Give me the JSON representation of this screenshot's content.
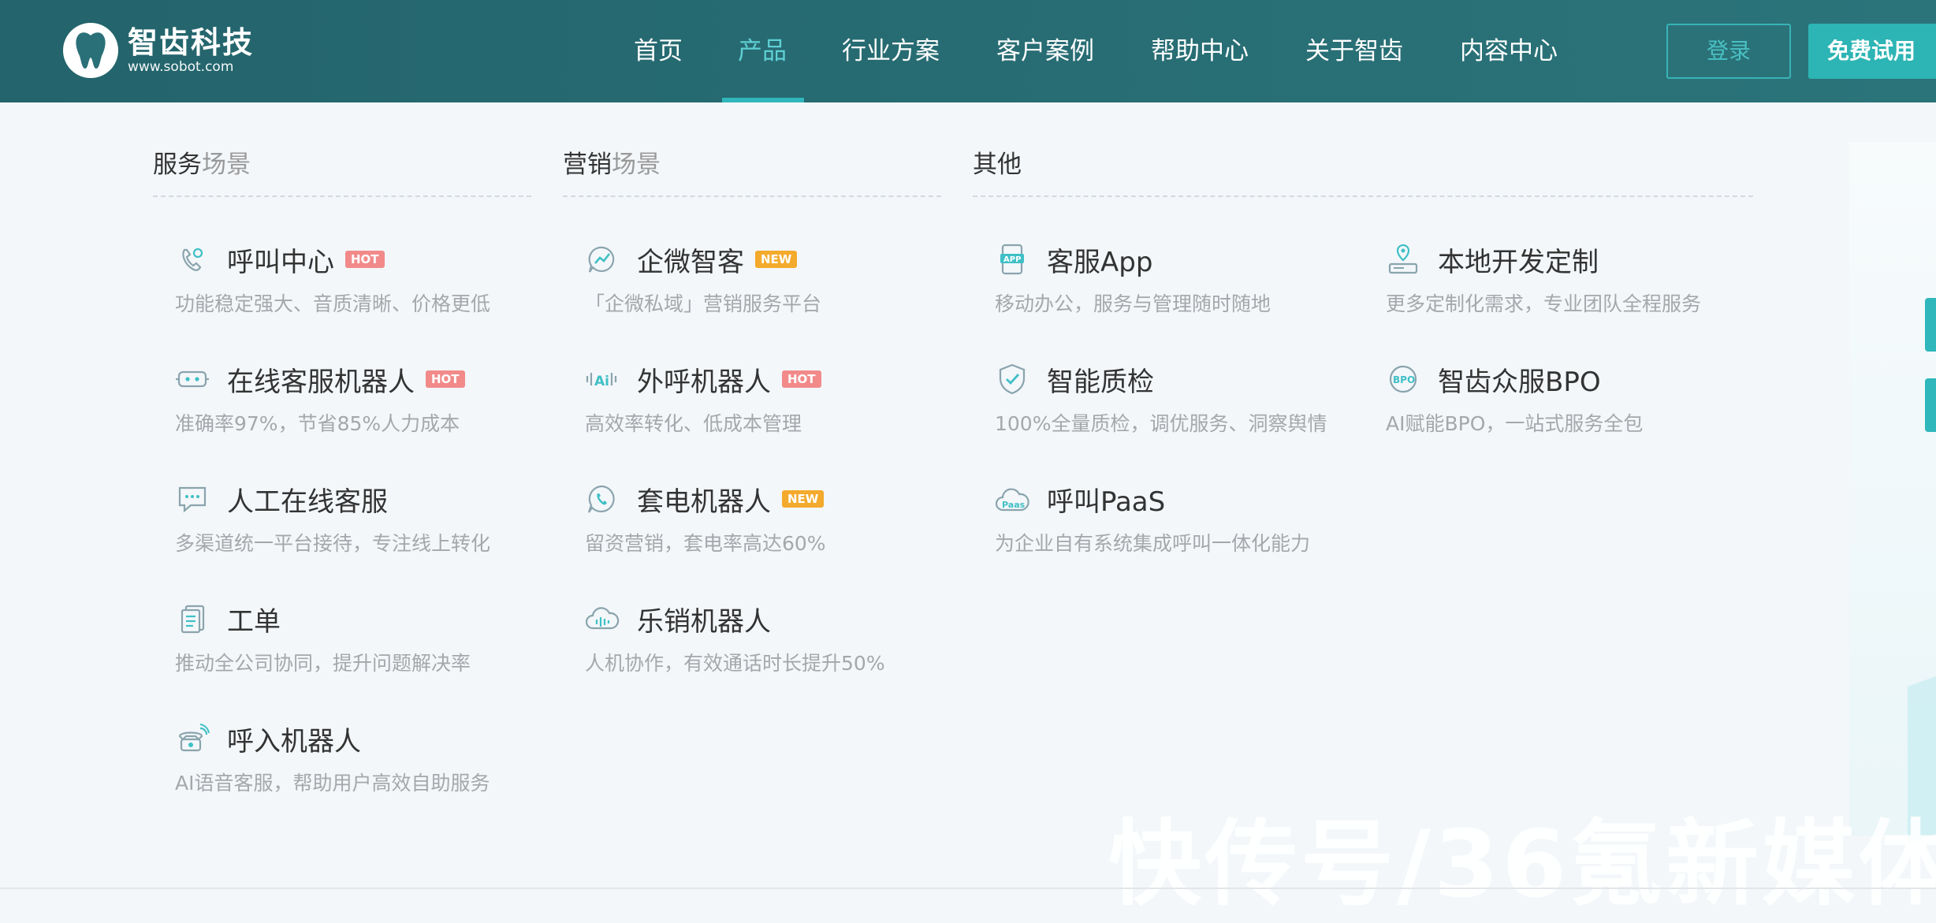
{
  "header": {
    "logo_cn": "智齿科技",
    "logo_url": "www.sobot.com",
    "nav": [
      {
        "label": "首页"
      },
      {
        "label": "产品",
        "active": true
      },
      {
        "label": "行业方案"
      },
      {
        "label": "客户案例"
      },
      {
        "label": "帮助中心"
      },
      {
        "label": "关于智齿"
      },
      {
        "label": "内容中心"
      }
    ],
    "login_label": "登录",
    "trial_label": "免费试用"
  },
  "menu": {
    "service": {
      "title_main": "服务",
      "title_sub": "场景",
      "items": [
        {
          "name": "呼叫中心",
          "badge": "HOT",
          "desc": "功能稳定强大、音质清晰、价格更低",
          "icon": "phone-call-icon"
        },
        {
          "name": "在线客服机器人",
          "badge": "HOT",
          "desc": "准确率97%，节省85%人力成本",
          "icon": "robot-icon"
        },
        {
          "name": "人工在线客服",
          "desc": "多渠道统一平台接待，专注线上转化",
          "icon": "chat-bubble-icon"
        },
        {
          "name": "工单",
          "desc": "推动全公司协同，提升问题解决率",
          "icon": "document-icon"
        },
        {
          "name": "呼入机器人",
          "desc": "AI语音客服，帮助用户高效自助服务",
          "icon": "telephone-icon"
        }
      ]
    },
    "marketing": {
      "title_main": "营销",
      "title_sub": "场景",
      "items": [
        {
          "name": "企微智客",
          "badge": "NEW",
          "desc": "「企微私域」营销服务平台",
          "icon": "trend-chat-icon"
        },
        {
          "name": "外呼机器人",
          "badge": "HOT",
          "desc": "高效率转化、低成本管理",
          "icon": "ai-voice-icon"
        },
        {
          "name": "套电机器人",
          "badge": "NEW",
          "desc": "留资营销，套电率高达60%",
          "icon": "phone-bubble-icon"
        },
        {
          "name": "乐销机器人",
          "desc": "人机协作，有效通话时长提升50%",
          "icon": "cloud-wave-icon"
        }
      ]
    },
    "other": {
      "title_main": "其他",
      "items": [
        {
          "name": "客服App",
          "desc": "移动办公，服务与管理随时随地",
          "icon": "app-icon"
        },
        {
          "name": "本地开发定制",
          "desc": "更多定制化需求，专业团队全程服务",
          "icon": "server-pin-icon"
        },
        {
          "name": "智能质检",
          "desc": "100%全量质检，调优服务、洞察舆情",
          "icon": "shield-check-icon"
        },
        {
          "name": "智齿众服BPO",
          "desc": "AI赋能BPO，一站式服务全包",
          "icon": "bpo-icon"
        },
        {
          "name": "呼叫PaaS",
          "desc": "为企业自有系统集成呼叫一体化能力",
          "icon": "paas-cloud-icon"
        }
      ]
    }
  },
  "watermark": "快传号/36氪新媒体",
  "colors": {
    "header_bg": "#24646c",
    "accent": "#2fb7bc",
    "hot": "#f28a8a",
    "new": "#f4aa2c"
  }
}
